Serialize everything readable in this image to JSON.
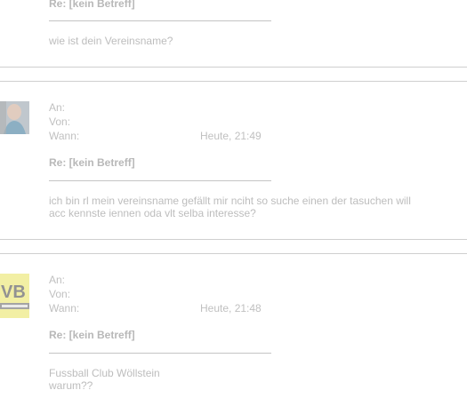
{
  "messages": [
    {
      "subject": "Re: [kein Betreff]",
      "body": "wie ist dein Vereinsname?"
    },
    {
      "to_label": "An:",
      "from_label": "Von:",
      "when_label": "Wann:",
      "time": "Heute, 21:49",
      "subject": "Re: [kein Betreff]",
      "body_line1": "ich bin rl mein vereinsname gefällt mir nciht so suche einen der tasuchen will",
      "body_line2": "acc kennste iennen oda vlt selba interesse?"
    },
    {
      "to_label": "An:",
      "from_label": "Von:",
      "when_label": "Wann:",
      "time": "Heute, 21:48",
      "subject": "Re: [kein Betreff]",
      "body_line1": "Fussball Club Wöllstein",
      "body_line2": "warum??"
    }
  ]
}
